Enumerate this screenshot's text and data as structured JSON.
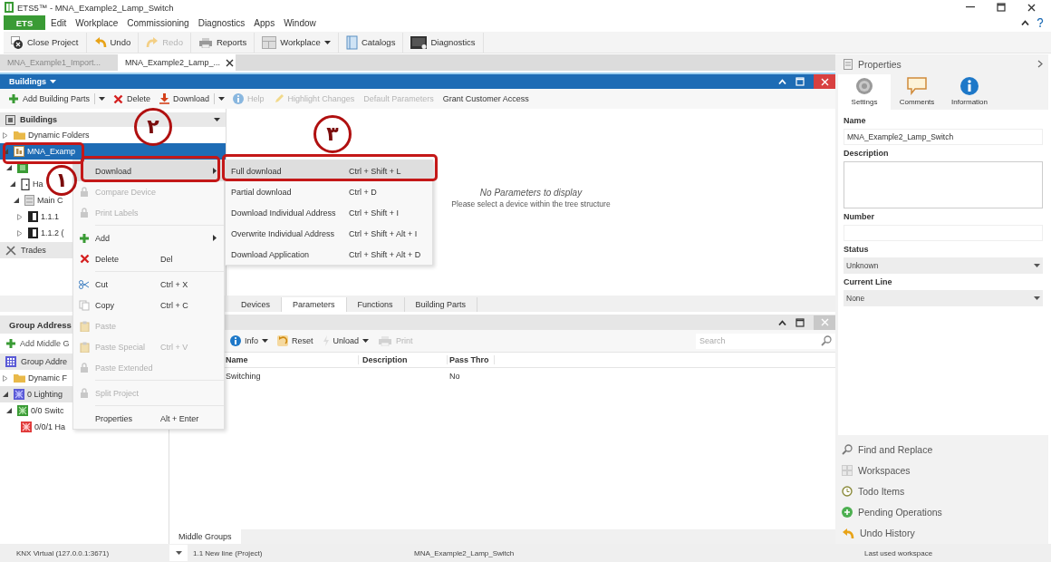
{
  "window": {
    "title": "ETS5™ - MNA_Example2_Lamp_Switch"
  },
  "menu_bar": {
    "app_button": "ETS",
    "items": [
      "Edit",
      "Workplace",
      "Commissioning",
      "Diagnostics",
      "Apps",
      "Window"
    ]
  },
  "toolbar": [
    {
      "label": "Close Project",
      "kind": "button",
      "disabled": false
    },
    {
      "label": "Undo",
      "kind": "button",
      "disabled": false
    },
    {
      "label": "Redo",
      "kind": "button",
      "disabled": true
    },
    {
      "label": "Reports",
      "kind": "button",
      "disabled": false
    },
    {
      "label": "Workplace",
      "kind": "menu",
      "disabled": false
    },
    {
      "label": "Catalogs",
      "kind": "button",
      "disabled": false
    },
    {
      "label": "Diagnostics",
      "kind": "button",
      "disabled": false
    }
  ],
  "document_tabs": [
    {
      "label": "MNA_Example1_Import...",
      "selected": false
    },
    {
      "label": "MNA_Example2_Lamp_...",
      "selected": true
    }
  ],
  "buildings_panel": {
    "title": "Buildings",
    "toolbar": [
      {
        "label": "Add Building Parts",
        "kind": "split",
        "disabled": false
      },
      {
        "label": "Delete",
        "kind": "button",
        "disabled": false
      },
      {
        "label": "Download",
        "kind": "split",
        "disabled": false
      },
      {
        "label": "Help",
        "kind": "button",
        "disabled": true
      },
      {
        "label": "Highlight Changes",
        "kind": "button",
        "disabled": true
      },
      {
        "label": "Default Parameters",
        "kind": "button",
        "disabled": true
      },
      {
        "label": "Grant Customer Access",
        "kind": "button",
        "disabled": false
      }
    ],
    "tree_header": "Buildings",
    "tree": [
      {
        "label": "Dynamic Folders",
        "kind": "folder",
        "expanded": false,
        "selected": false
      },
      {
        "label": "MNA_Examp",
        "kind": "project",
        "expanded": true,
        "selected": true,
        "children": [
          {
            "kind": "building",
            "expanded": true,
            "selected": false,
            "children": [
              {
                "label": "Ha",
                "kind": "floor",
                "expanded": true,
                "selected": false,
                "children": [
                  {
                    "label": "Main C",
                    "kind": "cabinet",
                    "expanded": true,
                    "selected": false,
                    "children": [
                      {
                        "label": "1.1.1",
                        "kind": "device",
                        "expanded": false,
                        "selected": false
                      },
                      {
                        "label": "1.1.2 (",
                        "kind": "device",
                        "expanded": false,
                        "selected": false
                      }
                    ]
                  }
                ]
              }
            ]
          }
        ]
      }
    ],
    "trades": "Trades",
    "empty_title": "No Parameters to display",
    "empty_hint": "Please select a device within the tree structure",
    "tabs": [
      {
        "label": "Devices",
        "selected": false
      },
      {
        "label": "Parameters",
        "selected": true
      },
      {
        "label": "Functions",
        "selected": false
      },
      {
        "label": "Building Parts",
        "selected": false
      }
    ]
  },
  "context_menu": [
    {
      "kind": "item",
      "label": "Download",
      "submenu": true,
      "disabled": false,
      "selected": true
    },
    {
      "kind": "item",
      "label": "Compare Device",
      "submenu": false,
      "disabled": true,
      "selected": false
    },
    {
      "kind": "item",
      "label": "Print Labels",
      "submenu": false,
      "disabled": true,
      "selected": false
    },
    {
      "kind": "separator"
    },
    {
      "kind": "item",
      "label": "Add",
      "submenu": true,
      "disabled": false,
      "selected": false
    },
    {
      "kind": "item",
      "label": "Delete",
      "shortcut": "Del",
      "submenu": false,
      "disabled": false,
      "selected": false
    },
    {
      "kind": "separator"
    },
    {
      "kind": "item",
      "label": "Cut",
      "shortcut": "Ctrl + X",
      "submenu": false,
      "disabled": false,
      "selected": false
    },
    {
      "kind": "item",
      "label": "Copy",
      "shortcut": "Ctrl + C",
      "submenu": false,
      "disabled": false,
      "selected": false
    },
    {
      "kind": "item",
      "label": "Paste",
      "submenu": false,
      "disabled": true,
      "selected": false
    },
    {
      "kind": "item",
      "label": "Paste Special",
      "shortcut": "Ctrl + V",
      "submenu": false,
      "disabled": true,
      "selected": false
    },
    {
      "kind": "item",
      "label": "Paste Extended",
      "submenu": false,
      "disabled": true,
      "selected": false
    },
    {
      "kind": "separator"
    },
    {
      "kind": "item",
      "label": "Split Project",
      "submenu": false,
      "disabled": true,
      "selected": false
    },
    {
      "kind": "separator"
    },
    {
      "kind": "item",
      "label": "Properties",
      "shortcut": "Alt + Enter",
      "submenu": false,
      "disabled": false,
      "selected": false
    }
  ],
  "download_submenu": [
    {
      "label": "Full download",
      "shortcut": "Ctrl + Shift + L",
      "selected": true
    },
    {
      "label": "Partial download",
      "shortcut": "Ctrl + D",
      "selected": false
    },
    {
      "label": "Download Individual Address",
      "shortcut": "Ctrl + Shift + I",
      "selected": false
    },
    {
      "label": "Overwrite Individual Address",
      "shortcut": "Ctrl + Shift + Alt + I",
      "selected": false
    },
    {
      "label": "Download Application",
      "shortcut": "Ctrl + Shift + Alt + D",
      "selected": false
    }
  ],
  "annotations": [
    {
      "number": "۱"
    },
    {
      "number": "۲"
    },
    {
      "number": "۳"
    }
  ],
  "group_addresses_panel": {
    "title": "Group Address",
    "toolbar": "Add Middle G",
    "tree_header": "Group Addre",
    "tree": [
      {
        "label": "Dynamic F",
        "kind": "folder",
        "expanded": false,
        "selected": false
      },
      {
        "label": "0 Lighting",
        "kind": "main",
        "expanded": true,
        "selected": true,
        "children": [
          {
            "label": "0/0 Switc",
            "kind": "middle",
            "expanded": true,
            "selected": false,
            "children": [
              {
                "label": "0/0/1 Ha",
                "kind": "address",
                "selected": false
              }
            ]
          }
        ]
      }
    ],
    "toolbar_right": [
      {
        "label": "Info",
        "kind": "menu",
        "disabled": false
      },
      {
        "label": "Reset",
        "kind": "button",
        "disabled": false
      },
      {
        "label": "Unload",
        "kind": "menu",
        "disabled": false
      },
      {
        "label": "Print",
        "kind": "button",
        "disabled": true
      }
    ],
    "search": {
      "placeholder": "Search"
    },
    "columns": [
      "Name",
      "Description",
      "Pass Thro"
    ],
    "rows": [
      {
        "name": "Switching",
        "pass_through": "No"
      }
    ],
    "bottom_tab": "Middle Groups"
  },
  "properties_panel": {
    "title": "Properties",
    "tabs": [
      {
        "label": "Settings",
        "selected": true
      },
      {
        "label": "Comments",
        "selected": false
      },
      {
        "label": "Information",
        "selected": false
      }
    ],
    "fields": [
      {
        "label": "Name",
        "kind": "text",
        "value": "MNA_Example2_Lamp_Switch"
      },
      {
        "label": "Description",
        "kind": "textarea"
      },
      {
        "label": "Number",
        "kind": "text"
      },
      {
        "label": "Status",
        "kind": "select",
        "value": "Unknown"
      },
      {
        "label": "Current Line",
        "kind": "select",
        "value": "None"
      }
    ]
  },
  "side_panels": [
    "Find and Replace",
    "Workspaces",
    "Todo Items",
    "Pending Operations",
    "Undo History"
  ],
  "status_bar": {
    "connection": "KNX Virtual (127.0.0.1:3671)",
    "line": "1.1 New line (Project)",
    "project": "MNA_Example2_Lamp_Switch",
    "workspace": "Last used workspace"
  }
}
